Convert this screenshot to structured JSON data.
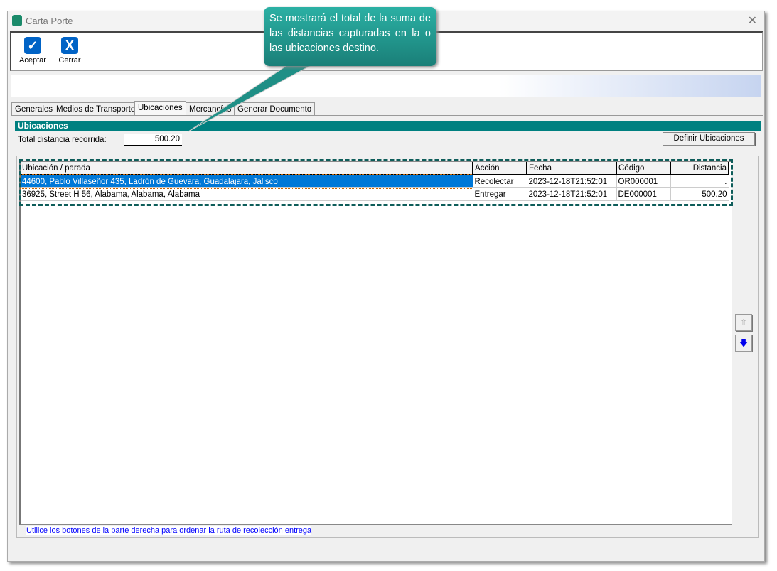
{
  "window": {
    "title": "Carta Porte",
    "close": "✕"
  },
  "toolbar": {
    "accept": "Aceptar",
    "close": "Cerrar"
  },
  "tabs": [
    "Generales",
    "Medios de Transporte",
    "Ubicaciones",
    "Mercancías",
    "Generar Documento"
  ],
  "panel": {
    "header": "Ubicaciones",
    "total_label": "Total distancia recorrida:",
    "total_value": "500.20",
    "define_button": "Definir Ubicaciones"
  },
  "table": {
    "columns": [
      "Ubicación / parada",
      "Acción",
      "Fecha",
      "Código",
      "Distancia"
    ],
    "rows": [
      [
        "44600, Pablo Villaseñor 435, Ladrón de Guevara, Guadalajara, Jalisco",
        "Recolectar",
        "2023-12-18T21:52:01",
        "OR000001",
        "."
      ],
      [
        "36925, Street H 56, Alabama, Alabama, Alabama",
        "Entregar",
        "2023-12-18T21:52:01",
        "DE000001",
        "500.20"
      ]
    ]
  },
  "footer": "Utilice los botones de la parte derecha para ordenar la ruta de recolección entrega",
  "callout": "Se mostrará el total de la suma de las distancias capturadas en la o las ubicaciones destino.",
  "colors": {
    "teal": "#008080",
    "selection": "#0078d7",
    "accent": "#0063c6"
  }
}
